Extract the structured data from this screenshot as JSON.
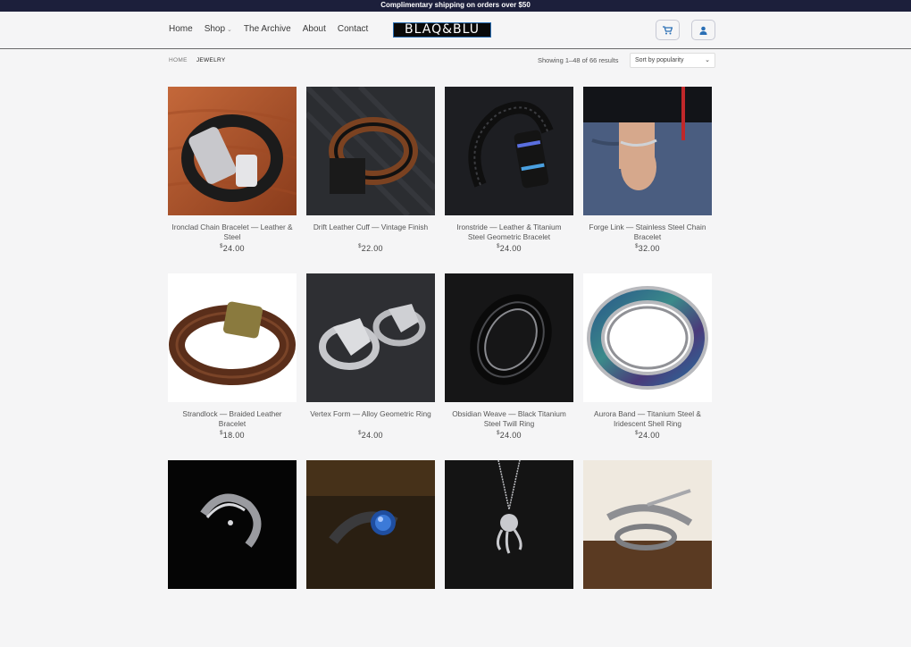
{
  "topbar": {
    "text": "Complimentary shipping on orders over $50"
  },
  "nav": {
    "home": "Home",
    "shop": "Shop",
    "archive": "The Archive",
    "about": "About",
    "contact": "Contact"
  },
  "logo": {
    "text": "BLAQ&BLU"
  },
  "breadcrumb": {
    "home": "HOME",
    "current": "JEWELRY"
  },
  "results": {
    "text": "Showing 1–48 of 66 results"
  },
  "sort": {
    "selected": "Sort by popularity"
  },
  "currency": "$",
  "products": [
    {
      "name": "Ironclad Chain Bracelet — Leather & Steel",
      "price": "24.00",
      "image": "braided-leather-steel-bracelet"
    },
    {
      "name": "Drift Leather Cuff — Vintage Finish",
      "price": "22.00",
      "image": "brown-leather-cuff"
    },
    {
      "name": "Ironstride — Leather & Titanium Steel Geometric Bracelet",
      "price": "24.00",
      "image": "black-braided-bracelet"
    },
    {
      "name": "Forge Link — Stainless Steel Chain Bracelet",
      "price": "32.00",
      "image": "chain-bracelet-on-wrist"
    },
    {
      "name": "Strandlock — Braided Leather Bracelet",
      "price": "18.00",
      "image": "layered-leather-bracelet"
    },
    {
      "name": "Vertex Form — Alloy Geometric Ring",
      "price": "24.00",
      "image": "geometric-rings"
    },
    {
      "name": "Obsidian Weave — Black Titanium Steel Twill Ring",
      "price": "24.00",
      "image": "black-twill-ring"
    },
    {
      "name": "Aurora Band — Titanium Steel & Iridescent Shell Ring",
      "price": "24.00",
      "image": "abalone-inlay-ring"
    },
    {
      "name": "",
      "price": "",
      "image": "octopus-ring"
    },
    {
      "name": "",
      "price": "",
      "image": "octopus-blue-stone-ring"
    },
    {
      "name": "",
      "price": "",
      "image": "octopus-pendant-necklace"
    },
    {
      "name": "",
      "price": "",
      "image": "swordfish-ring"
    }
  ]
}
